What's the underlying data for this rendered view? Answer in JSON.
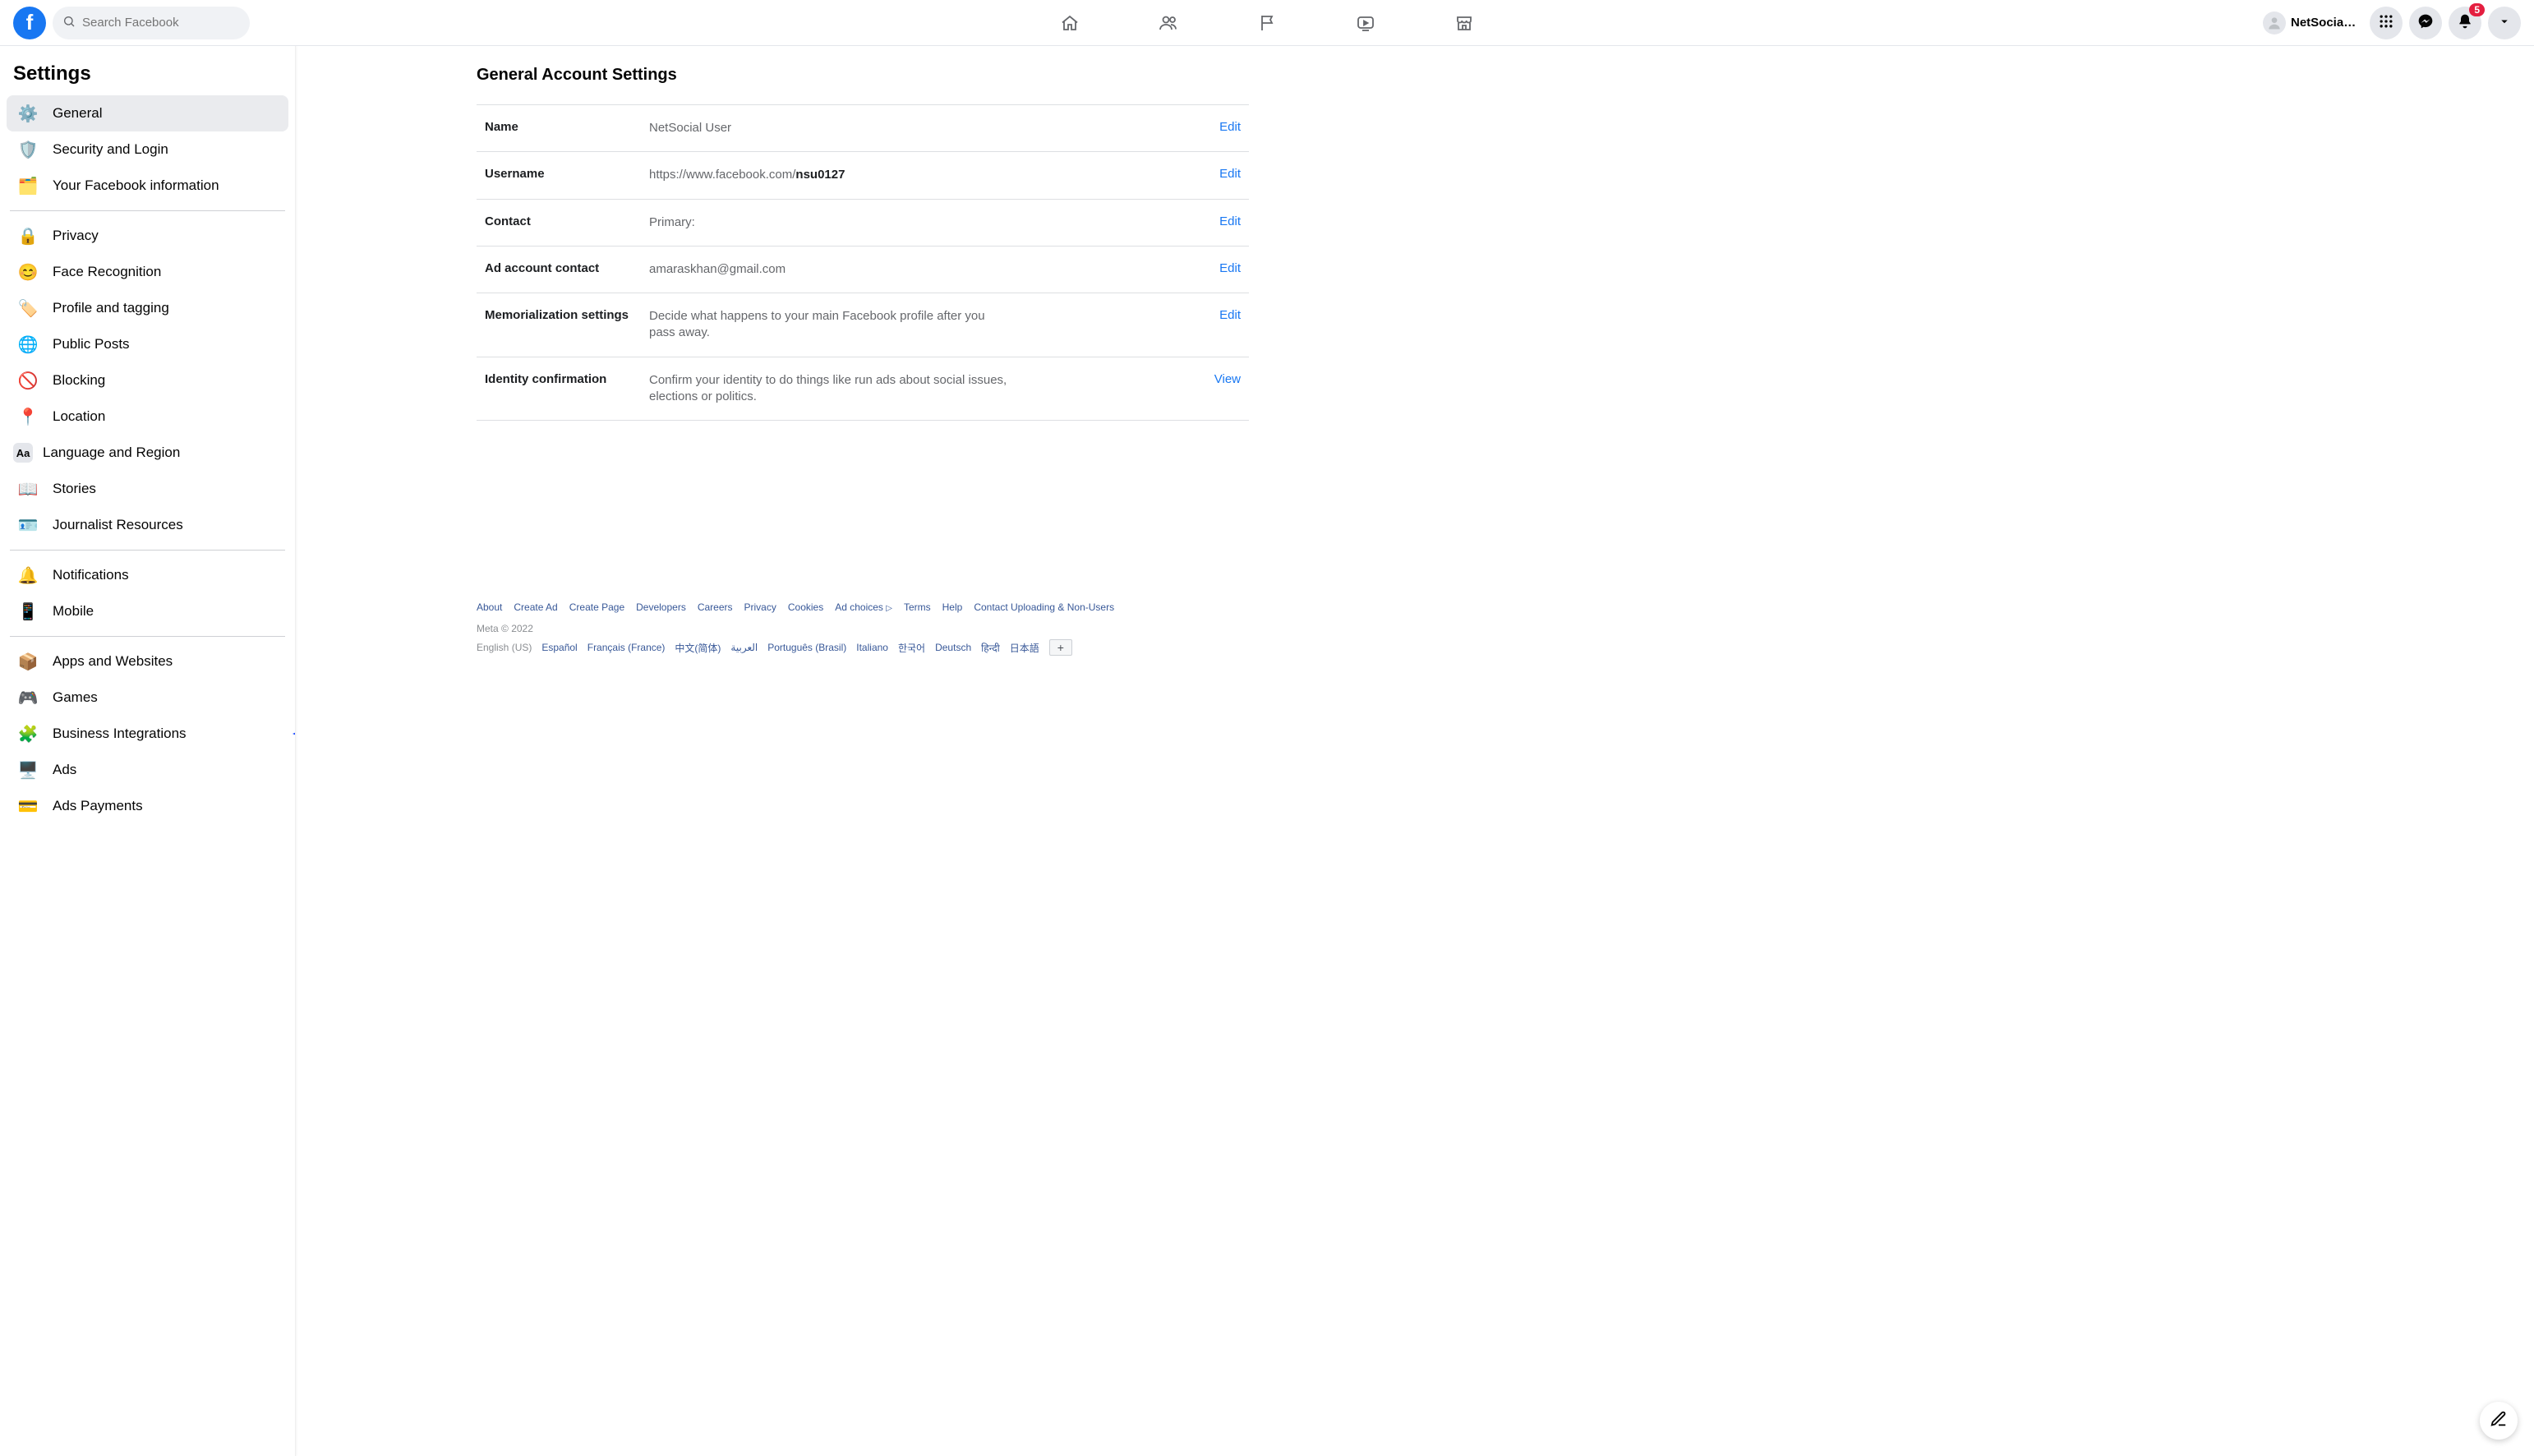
{
  "header": {
    "search_placeholder": "Search Facebook",
    "profile_name": "NetSocial ...",
    "notification_count": "5"
  },
  "sidebar": {
    "title": "Settings",
    "groups": [
      [
        {
          "label": "General",
          "icon": "⚙️",
          "active": true
        },
        {
          "label": "Security and Login",
          "icon": "🛡️"
        },
        {
          "label": "Your Facebook information",
          "icon": "🗂️"
        }
      ],
      [
        {
          "label": "Privacy",
          "icon": "🔒"
        },
        {
          "label": "Face Recognition",
          "icon": "😊"
        },
        {
          "label": "Profile and tagging",
          "icon": "🏷️"
        },
        {
          "label": "Public Posts",
          "icon": "🌐"
        },
        {
          "label": "Blocking",
          "icon": "🚫"
        },
        {
          "label": "Location",
          "icon": "📍"
        },
        {
          "label": "Language and Region",
          "icon": "Aa",
          "text_icon": true
        },
        {
          "label": "Stories",
          "icon": "📖"
        },
        {
          "label": "Journalist Resources",
          "icon": "🪪"
        }
      ],
      [
        {
          "label": "Notifications",
          "icon": "🔔"
        },
        {
          "label": "Mobile",
          "icon": "📱"
        }
      ],
      [
        {
          "label": "Apps and Websites",
          "icon": "📦"
        },
        {
          "label": "Games",
          "icon": "🎮"
        },
        {
          "label": "Business Integrations",
          "icon": "🧩",
          "arrow": true
        },
        {
          "label": "Ads",
          "icon": "🖥️"
        },
        {
          "label": "Ads Payments",
          "icon": "💳"
        }
      ]
    ]
  },
  "main": {
    "title": "General Account Settings",
    "rows": [
      {
        "label": "Name",
        "value_plain": "NetSocial User",
        "action": "Edit"
      },
      {
        "label": "Username",
        "value_prefix": "https://www.facebook.com/",
        "value_strong": "nsu0127",
        "action": "Edit"
      },
      {
        "label": "Contact",
        "value_plain": "Primary:",
        "action": "Edit"
      },
      {
        "label": "Ad account contact",
        "value_plain": "amaraskhan@gmail.com",
        "action": "Edit"
      },
      {
        "label": "Memorialization settings",
        "value_plain": "Decide what happens to your main Facebook profile after you pass away.",
        "action": "Edit"
      },
      {
        "label": "Identity confirmation",
        "value_plain": "Confirm your identity to do things like run ads about social issues, elections or politics.",
        "action": "View"
      }
    ]
  },
  "footer": {
    "links": [
      "About",
      "Create Ad",
      "Create Page",
      "Developers",
      "Careers",
      "Privacy",
      "Cookies",
      "Ad choices",
      "Terms",
      "Help",
      "Contact Uploading & Non-Users"
    ],
    "copyright": "Meta © 2022",
    "lang_current": "English (US)",
    "langs": [
      "Español",
      "Français (France)",
      "中文(简体)",
      "العربية",
      "Português (Brasil)",
      "Italiano",
      "한국어",
      "Deutsch",
      "हिन्दी",
      "日本語"
    ],
    "plus": "+"
  }
}
